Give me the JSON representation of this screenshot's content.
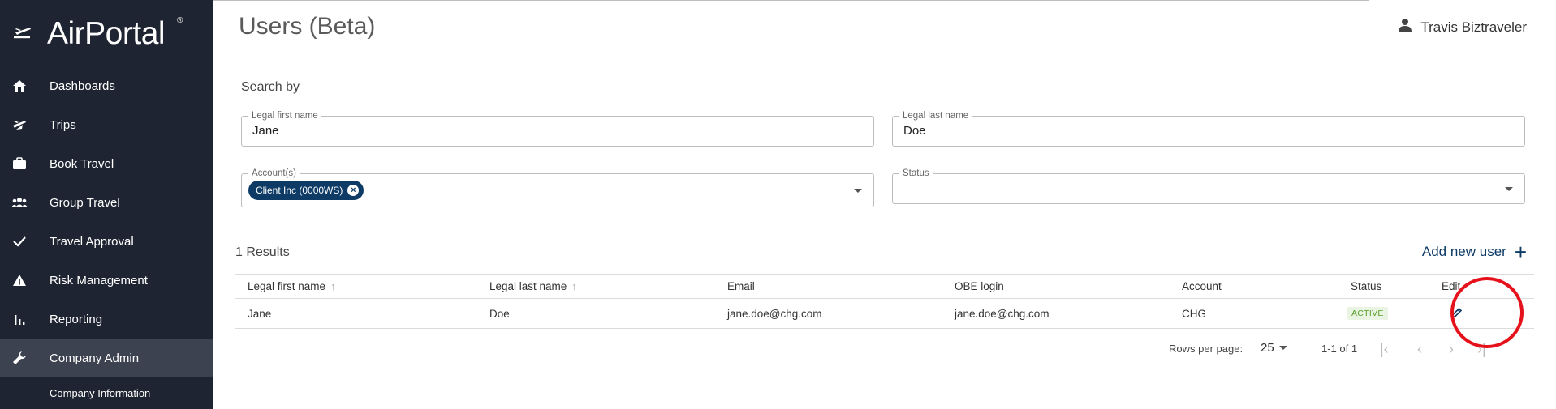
{
  "brand": {
    "name": "AirPortal",
    "reg": "®"
  },
  "sidebar": {
    "items": [
      {
        "label": "Dashboards",
        "icon": "home-icon"
      },
      {
        "label": "Trips",
        "icon": "plane-icon"
      },
      {
        "label": "Book Travel",
        "icon": "briefcase-icon"
      },
      {
        "label": "Group Travel",
        "icon": "group-icon"
      },
      {
        "label": "Travel Approval",
        "icon": "checkmark-icon"
      },
      {
        "label": "Risk Management",
        "icon": "warning-icon"
      },
      {
        "label": "Reporting",
        "icon": "bar-chart-icon"
      },
      {
        "label": "Company Admin",
        "icon": "wrench-icon",
        "active": true
      }
    ],
    "sub_item": "Company Information"
  },
  "header": {
    "title": "Users (Beta)",
    "user_name": "Travis Biztraveler"
  },
  "search": {
    "heading": "Search by",
    "first_name_label": "Legal first name",
    "first_name_value": "Jane",
    "last_name_label": "Legal last name",
    "last_name_value": "Doe",
    "accounts_label": "Account(s)",
    "accounts_chip": "Client Inc (0000WS)",
    "status_label": "Status",
    "status_value": ""
  },
  "results": {
    "count_text": "1 Results",
    "add_user_label": "Add new user"
  },
  "table": {
    "columns": [
      "Legal first name",
      "Legal last name",
      "Email",
      "OBE login",
      "Account",
      "Status",
      "Edit"
    ],
    "rows": [
      {
        "first": "Jane",
        "last": "Doe",
        "email": "jane.doe@chg.com",
        "obe": "jane.doe@chg.com",
        "account": "CHG",
        "status": "ACTIVE"
      }
    ]
  },
  "pagination": {
    "rows_per_page_label": "Rows per page:",
    "rows_per_page": "25",
    "range": "1-1 of 1"
  },
  "colors": {
    "sidebar_bg": "#1e2431",
    "accent": "#0d3b66",
    "active_badge": "#5c9e2e",
    "highlight": "#e5121b"
  }
}
